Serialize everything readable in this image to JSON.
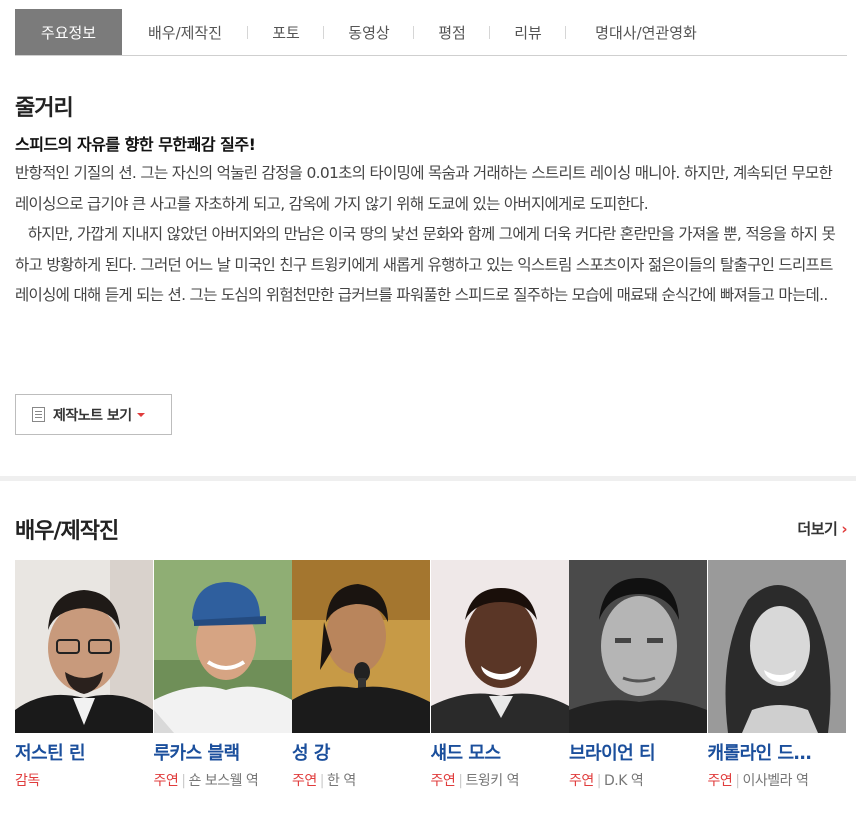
{
  "tabs": [
    {
      "label": "주요정보",
      "active": true
    },
    {
      "label": "배우/제작진"
    },
    {
      "label": "포토"
    },
    {
      "label": "동영상"
    },
    {
      "label": "평점"
    },
    {
      "label": "리뷰"
    },
    {
      "label": "명대사/연관영화"
    }
  ],
  "synopsis": {
    "title": "줄거리",
    "headline": "스피드의 자유를 향한 무한쾌감 질주!",
    "body": "반항적인 기질의 션. 그는 자신의 억눌린 감정을 0.01초의 타이밍에 목숨과 거래하는 스트리트 레이싱 매니아. 하지만, 계속되던 무모한 레이싱으로 급기야 큰 사고를 자초하게 되고, 감옥에 가지 않기 위해 도쿄에 있는 아버지에게로 도피한다.\n   하지만, 가깝게 지내지 않았던 아버지와의 만남은 이국 땅의 낯선 문화와 함께 그에게 더욱 커다란 혼란만을 가져올 뿐, 적응을 하지 못하고 방황하게 된다. 그러던 어느 날 미국인 친구 트윙키에게 새롭게 유행하고 있는 익스트림 스포츠이자 젊은이들의 탈출구인 드리프트 레이싱에 대해 듣게 되는 션. 그는 도심의 위험천만한 급커브를 파워풀한 스피드로 질주하는 모습에 매료돼 순식간에 빠져들고 마는데..",
    "note_button": "제작노트 보기"
  },
  "cast_section": {
    "title": "배우/제작진",
    "more": "더보기",
    "members": [
      {
        "name": "저스틴 린",
        "role": "감독",
        "character": ""
      },
      {
        "name": "루카스 블랙",
        "role": "주연",
        "character": "숀 보스웰 역"
      },
      {
        "name": "성 강",
        "role": "주연",
        "character": "한 역"
      },
      {
        "name": "섀드 모스",
        "role": "주연",
        "character": "트윙키 역"
      },
      {
        "name": "브라이언 티",
        "role": "주연",
        "character": "D.K 역"
      },
      {
        "name": "캐롤라인 드…",
        "role": "주연",
        "character": "이사벨라 역"
      }
    ]
  },
  "colors": {
    "accent": "#e03c3c",
    "link": "#1b4f9c",
    "active_tab": "#7b7b7b"
  }
}
